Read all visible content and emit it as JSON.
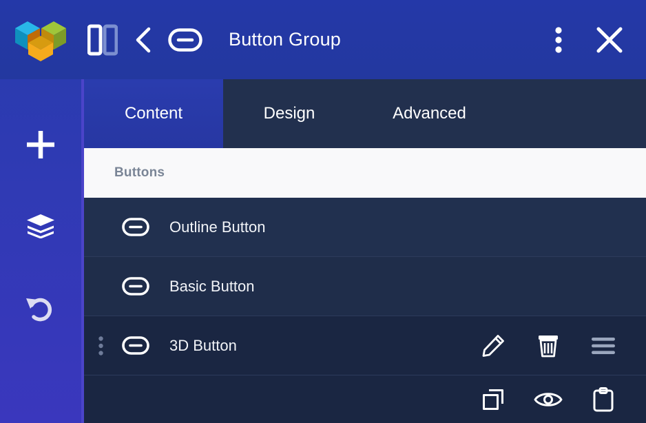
{
  "header": {
    "title": "Button Group",
    "logo_name": "elementor-cubes-logo",
    "logo_colors": {
      "cyan_top": "#29b6e8",
      "cyan_left": "#0f90bd",
      "orange_right": "#bf6b08",
      "green_top": "#a0c63a",
      "green_right": "#7d9c28",
      "gold_top": "#d79b10",
      "amber_bottom": "#f5ab1c"
    },
    "icons": [
      {
        "name": "panel-layout-icon",
        "label": "Panel Layout"
      },
      {
        "name": "chevron-left-icon",
        "label": "Back"
      },
      {
        "name": "button-pill-icon",
        "label": "Button Widget"
      }
    ],
    "right_icons": [
      {
        "name": "kebab-menu-icon",
        "label": "More Options"
      },
      {
        "name": "close-icon",
        "label": "Close"
      }
    ],
    "background_color": "#2438a8"
  },
  "sidebar": {
    "items": [
      {
        "name": "add-element-icon",
        "label": "Add Element"
      },
      {
        "name": "layers-icon",
        "label": "Navigator"
      },
      {
        "name": "undo-history-icon",
        "label": "History"
      }
    ],
    "background_color": "#2f3ab4"
  },
  "tabs": [
    {
      "label": "Content",
      "active": true
    },
    {
      "label": "Design",
      "active": false
    },
    {
      "label": "Advanced",
      "active": false
    }
  ],
  "section": {
    "title": "Buttons"
  },
  "list": {
    "items": [
      {
        "label": "Outline Button",
        "icon": "button-pill-icon",
        "selected": false,
        "has_handle": false,
        "actions": []
      },
      {
        "label": "Basic Button",
        "icon": "button-pill-icon",
        "selected": false,
        "has_handle": false,
        "actions": []
      },
      {
        "label": "3D Button",
        "icon": "button-pill-icon",
        "selected": true,
        "has_handle": true,
        "actions": [
          {
            "name": "edit-pencil-icon",
            "label": "Edit"
          },
          {
            "name": "trash-delete-icon",
            "label": "Delete"
          },
          {
            "name": "hamburger-sort-icon",
            "label": "Reorder"
          }
        ]
      }
    ],
    "trailing_actions": [
      {
        "name": "duplicate-copy-icon",
        "label": "Duplicate"
      },
      {
        "name": "eye-visibility-icon",
        "label": "Preview"
      },
      {
        "name": "clipboard-paste-icon",
        "label": "Paste"
      }
    ]
  },
  "colors": {
    "accent_strip": "#4b44c9",
    "row_default": "#21304f",
    "row_selected": "#1a2642",
    "panel_bg": "#1b2742",
    "tabbar_bg": "#22304e",
    "section_bg": "#f9f9fa",
    "section_text": "#7a8596"
  }
}
